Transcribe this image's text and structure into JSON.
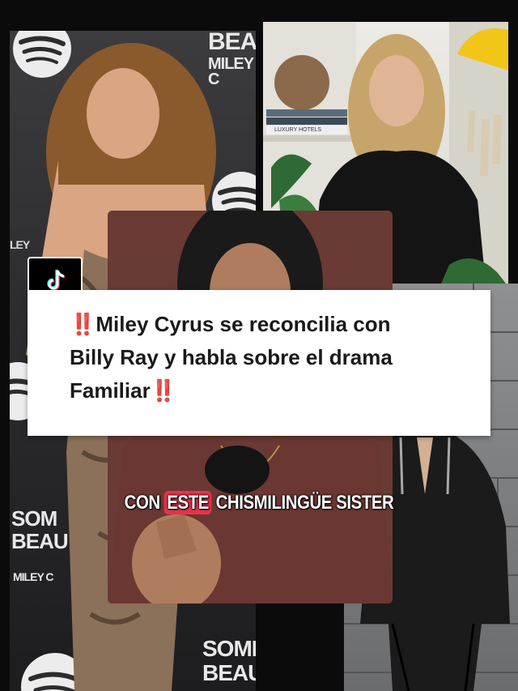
{
  "headline": {
    "prefix_icon": "‼️",
    "line1": "Miley Cyrus se reconcilia con",
    "line2": "Billy Ray y habla sobre el drama",
    "line3": "Familiar",
    "suffix_icon": "‼️"
  },
  "caption": {
    "before": "CON",
    "highlight": "ESTE",
    "after": "CHISMILINGÜE SISTER"
  },
  "backdrop": {
    "top_text_1": "BEAU",
    "top_text_2": "MILEY C",
    "mid_text_1": "SOM",
    "mid_text_2": "BEAU",
    "mid_text_3": "MILEY C",
    "bottom_text_1": "SOMETH",
    "bottom_text_2": "BEAUTI",
    "left_text": "LEY"
  },
  "book_spine": "LUXURY HOTELS",
  "colors": {
    "caption_highlight": "#e8334a",
    "card_background": "#ffffff",
    "headline_text": "#1a1a1a"
  },
  "icons": {
    "tiktok": "tiktok-icon",
    "alert": "double-exclamation-icon",
    "spotify": "spotify-icon"
  }
}
